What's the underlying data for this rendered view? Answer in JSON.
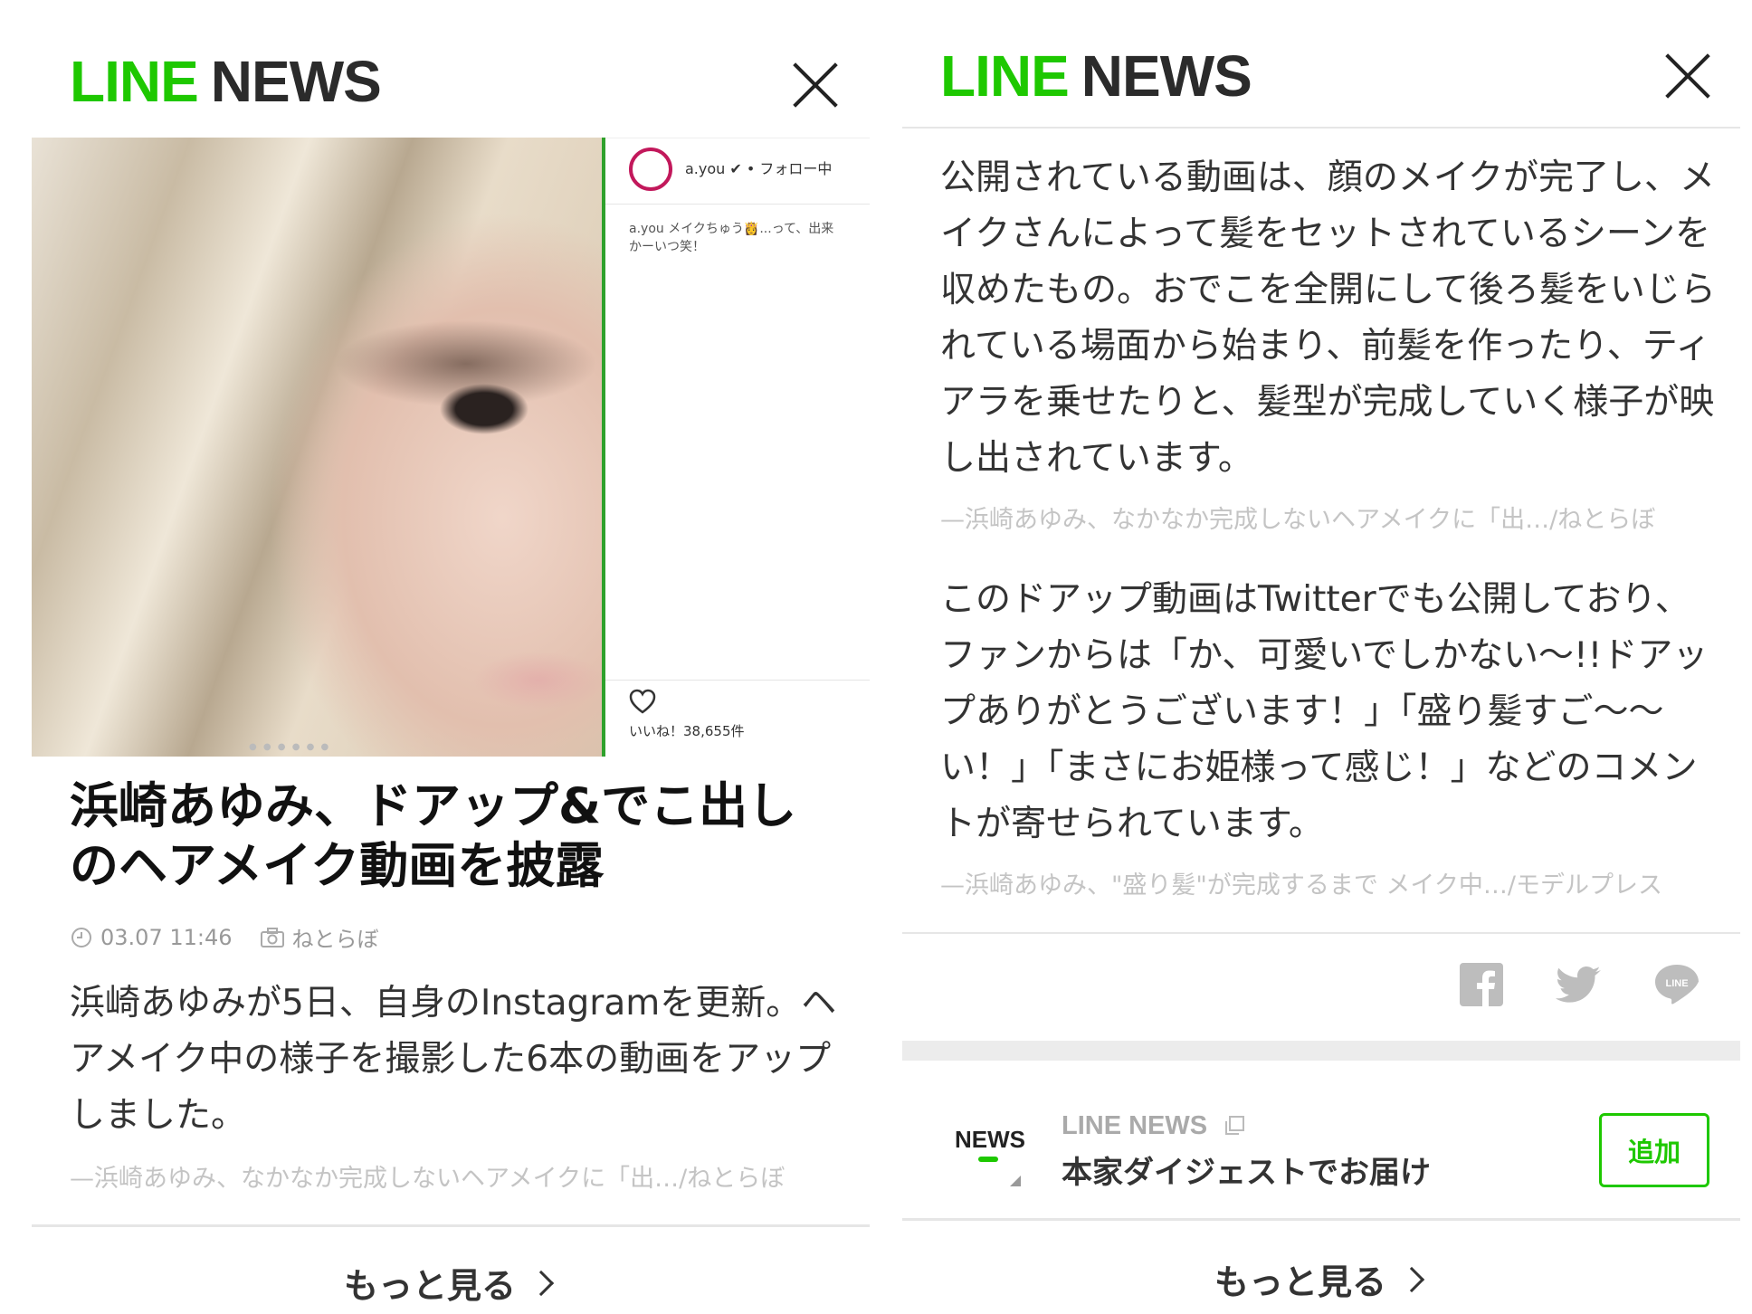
{
  "left": {
    "logo_green": "LINE",
    "logo_dark": "NEWS",
    "insta_user": "a.you ✔ • フォロー中",
    "insta_caption": "a.you メイクちゅう👸...って、出来\nかーいつ笑！",
    "insta_likes": "いいね！38,655件",
    "headline": "浜崎あゆみ、ドアップ&でこ出しのヘアメイク動画を披露",
    "meta_time": "03.07 11:46",
    "meta_source": "ねとらぼ",
    "body": "浜崎あゆみが5日、自身のInstagramを更新。ヘアメイク中の様子を撮影した6本の動画をアップしました。",
    "source_line": "—浜崎あゆみ、なかなか完成しないヘアメイクに「出…/ねとらぼ",
    "more": "もっと見る"
  },
  "right": {
    "logo_green": "LINE",
    "logo_dark": "NEWS",
    "para1": "公開されている動画は、顔のメイクが完了し、メイクさんによって髪をセットされているシーンを収めたもの。おでこを全開にして後ろ髪をいじられている場面から始まり、前髪を作ったり、ティアラを乗せたりと、髪型が完成していく様子が映し出されています。",
    "source1": "—浜崎あゆみ、なかなか完成しないヘアメイクに「出…/ねとらぼ",
    "para2": "このドアップ動画はTwitterでも公開しており、ファンからは「か、可愛いでしかない〜!!ドアップありがとうございます！」「盛り髪すご〜〜い！」「まさにお姫様って感じ！」などのコメントが寄せられています。",
    "source2": "—浜崎あゆみ、\"盛り髪\"が完成するまで メイク中…/モデルプレス",
    "promo_badge": "NEWS",
    "promo_title": "LINE NEWS",
    "promo_sub": "本家ダイジェストでお届け",
    "add_label": "追加",
    "more": "もっと見る"
  },
  "colors": {
    "brand_green": "#1ec800",
    "muted": "#c4c4c4",
    "icon_grey": "#bdbdbd"
  }
}
